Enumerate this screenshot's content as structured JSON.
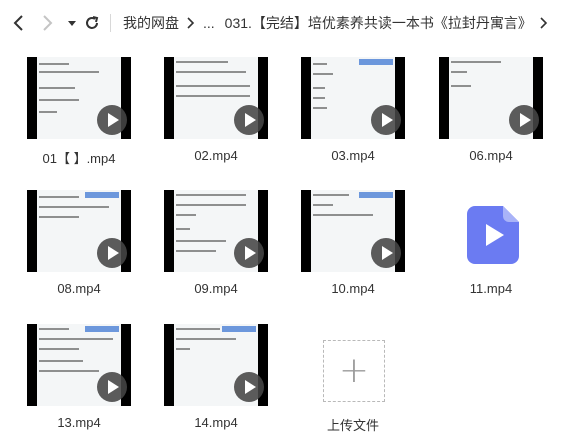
{
  "breadcrumb": {
    "root": "我的网盘",
    "ellipsis": "...",
    "current": "031.【完结】培优素养共读一本书《拉封丹寓言》"
  },
  "files": [
    {
      "name": "01【 】.mp4",
      "kind": "video"
    },
    {
      "name": "02.mp4",
      "kind": "video"
    },
    {
      "name": "03.mp4",
      "kind": "video"
    },
    {
      "name": "06.mp4",
      "kind": "video"
    },
    {
      "name": "08.mp4",
      "kind": "video"
    },
    {
      "name": "09.mp4",
      "kind": "video"
    },
    {
      "name": "10.mp4",
      "kind": "video"
    },
    {
      "name": "11.mp4",
      "kind": "video-icon"
    },
    {
      "name": "13.mp4",
      "kind": "video"
    },
    {
      "name": "14.mp4",
      "kind": "video"
    }
  ],
  "upload": {
    "label": "上传文件"
  },
  "colors": {
    "accent": "#6b7bf2",
    "play_bg": "#464646"
  }
}
